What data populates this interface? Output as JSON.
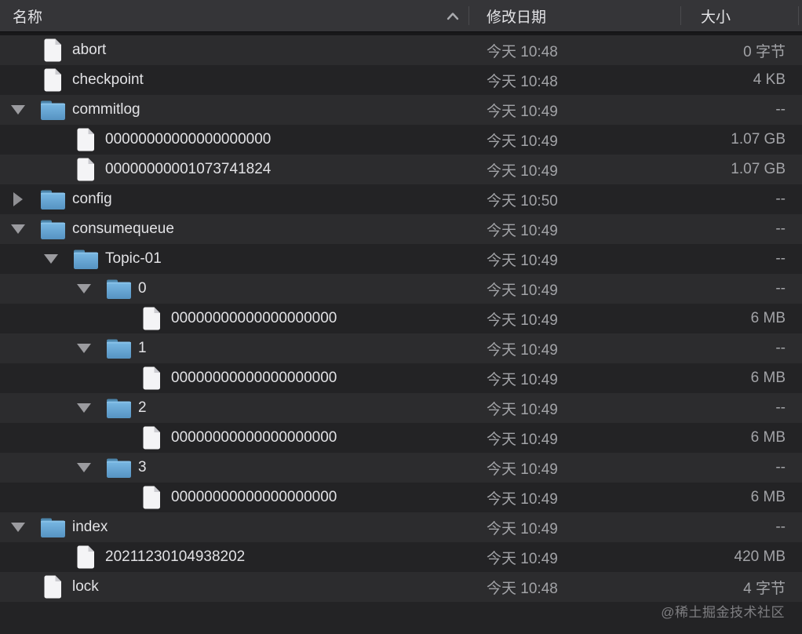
{
  "header": {
    "name_label": "名称",
    "date_label": "修改日期",
    "size_label": "大小",
    "sort_icon": "chevron-up-icon"
  },
  "colors": {
    "header_bg": "#353538",
    "row_light": "#2c2c2e",
    "row_dark": "#232325",
    "folder_blue": "#6cb0dd",
    "text_bright": "#e2e2e5",
    "text_dim": "#a2a3a7"
  },
  "rows": [
    {
      "name": "abort",
      "type": "file",
      "state": "none",
      "level": 0,
      "date": "今天 10:48",
      "size": "0 字节"
    },
    {
      "name": "checkpoint",
      "type": "file",
      "state": "none",
      "level": 0,
      "date": "今天 10:48",
      "size": "4 KB"
    },
    {
      "name": "commitlog",
      "type": "folder",
      "state": "expanded",
      "level": 0,
      "date": "今天 10:49",
      "size": "--"
    },
    {
      "name": "00000000000000000000",
      "type": "file",
      "state": "none",
      "level": 1,
      "date": "今天 10:49",
      "size": "1.07 GB"
    },
    {
      "name": "00000000001073741824",
      "type": "file",
      "state": "none",
      "level": 1,
      "date": "今天 10:49",
      "size": "1.07 GB"
    },
    {
      "name": "config",
      "type": "folder",
      "state": "collapsed",
      "level": 0,
      "date": "今天 10:50",
      "size": "--"
    },
    {
      "name": "consumequeue",
      "type": "folder",
      "state": "expanded",
      "level": 0,
      "date": "今天 10:49",
      "size": "--"
    },
    {
      "name": "Topic-01",
      "type": "folder",
      "state": "expanded",
      "level": 1,
      "date": "今天 10:49",
      "size": "--"
    },
    {
      "name": "0",
      "type": "folder",
      "state": "expanded",
      "level": 2,
      "date": "今天 10:49",
      "size": "--"
    },
    {
      "name": "00000000000000000000",
      "type": "file",
      "state": "none",
      "level": 3,
      "date": "今天 10:49",
      "size": "6 MB"
    },
    {
      "name": "1",
      "type": "folder",
      "state": "expanded",
      "level": 2,
      "date": "今天 10:49",
      "size": "--"
    },
    {
      "name": "00000000000000000000",
      "type": "file",
      "state": "none",
      "level": 3,
      "date": "今天 10:49",
      "size": "6 MB"
    },
    {
      "name": "2",
      "type": "folder",
      "state": "expanded",
      "level": 2,
      "date": "今天 10:49",
      "size": "--"
    },
    {
      "name": "00000000000000000000",
      "type": "file",
      "state": "none",
      "level": 3,
      "date": "今天 10:49",
      "size": "6 MB"
    },
    {
      "name": "3",
      "type": "folder",
      "state": "expanded",
      "level": 2,
      "date": "今天 10:49",
      "size": "--"
    },
    {
      "name": "00000000000000000000",
      "type": "file",
      "state": "none",
      "level": 3,
      "date": "今天 10:49",
      "size": "6 MB"
    },
    {
      "name": "index",
      "type": "folder",
      "state": "expanded",
      "level": 0,
      "date": "今天 10:49",
      "size": "--"
    },
    {
      "name": "20211230104938202",
      "type": "file",
      "state": "none",
      "level": 1,
      "date": "今天 10:49",
      "size": "420 MB"
    },
    {
      "name": "lock",
      "type": "file",
      "state": "none",
      "level": 0,
      "date": "今天 10:48",
      "size": "4 字节"
    }
  ],
  "watermark": "@稀土掘金技术社区"
}
